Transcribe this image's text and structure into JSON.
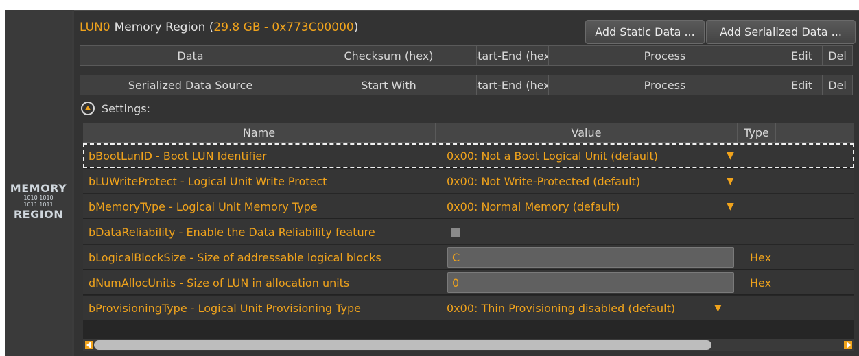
{
  "sidebar": {
    "logo_top": "MEMORY",
    "logo_bits_1": "1010 1010",
    "logo_bits_2": "1011 1011",
    "logo_bottom": "REGION"
  },
  "header": {
    "lun": "LUN0",
    "label": "Memory Region (",
    "size": "29.8 GB - 0x773C00000",
    "close": ")"
  },
  "buttons": {
    "add_static": "Add Static Data ...",
    "add_serialized": "Add Serialized Data ..."
  },
  "static_cols": [
    "Data",
    "Checksum (hex)",
    "Start-End (hex)",
    "Process",
    "Edit",
    "Del"
  ],
  "serial_cols": [
    "Serialized Data Source",
    "Start With",
    "Start-End (hex)",
    "Process",
    "Edit",
    "Del"
  ],
  "settings": {
    "label": "Settings:"
  },
  "grid": {
    "headers": [
      "Name",
      "Value",
      "Type"
    ],
    "rows": [
      {
        "name": "bBootLunID - Boot LUN Identifier",
        "value": "0x00: Not a Boot Logical Unit (default)",
        "kind": "dropdown"
      },
      {
        "name": "bLUWriteProtect - Logical Unit Write Protect",
        "value": "0x00: Not Write-Protected (default)",
        "kind": "dropdown"
      },
      {
        "name": "bMemoryType - Logical Unit Memory Type",
        "value": "0x00: Normal Memory (default)",
        "kind": "dropdown"
      },
      {
        "name": "bDataReliability - Enable the Data Reliability feature",
        "value": "",
        "kind": "checkbox"
      },
      {
        "name": "bLogicalBlockSize - Size of addressable logical blocks",
        "value": "C",
        "type": "Hex",
        "kind": "text"
      },
      {
        "name": "dNumAllocUnits - Size of LUN in allocation units",
        "value": "0",
        "type": "Hex",
        "kind": "text"
      },
      {
        "name": "bProvisioningType - Logical Unit Provisioning Type",
        "value": "0x00: Thin Provisioning disabled (default)",
        "kind": "dropdown"
      }
    ]
  },
  "colors": {
    "accent": "#f0a31c",
    "panel": "#333333",
    "row": "#353535"
  }
}
